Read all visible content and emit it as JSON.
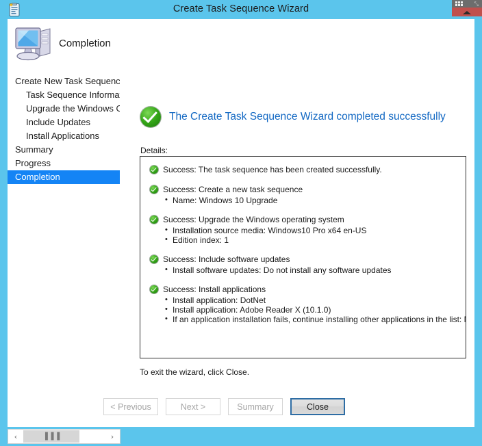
{
  "window": {
    "title": "Create Task Sequence Wizard",
    "title_icon": "task-sequence-clipboard-icon",
    "close_icon": "caret-up-icon",
    "accent_color": "#5BC5EC",
    "close_button_color": "#C0504D"
  },
  "overlay_toolbar": {
    "grip_icon": "drag-handle-dots-icon",
    "expand_icon": "expand-arrows-icon",
    "expand_glyph": "⤡"
  },
  "header": {
    "icon": "computer-monitor-icon",
    "title": "Completion"
  },
  "sidebar": {
    "selected_color": "#1484F5",
    "items": [
      {
        "label": "Create New Task Sequence",
        "level": 0,
        "selected": false
      },
      {
        "label": "Task Sequence Information",
        "level": 1,
        "selected": false
      },
      {
        "label": "Upgrade the Windows Operating System",
        "level": 1,
        "selected": false
      },
      {
        "label": "Include Updates",
        "level": 1,
        "selected": false
      },
      {
        "label": "Install Applications",
        "level": 1,
        "selected": false
      },
      {
        "label": "Summary",
        "level": 0,
        "selected": false
      },
      {
        "label": "Progress",
        "level": 0,
        "selected": false
      },
      {
        "label": "Completion",
        "level": 0,
        "selected": true
      }
    ]
  },
  "main": {
    "status_icon": "success-check-icon",
    "status_text": "The Create Task Sequence Wizard completed successfully",
    "status_color": "#1268C3",
    "details_label": "Details:",
    "exit_hint": "To exit the wizard, click Close.",
    "results": [
      {
        "icon": "success-check-icon",
        "heading": "Success: The task sequence has been created successfully.",
        "bullets": []
      },
      {
        "icon": "success-check-icon",
        "heading": "Success: Create a new task sequence",
        "bullets": [
          "Name: Windows 10 Upgrade"
        ]
      },
      {
        "icon": "success-check-icon",
        "heading": "Success: Upgrade the Windows operating system",
        "bullets": [
          "Installation source media:  Windows10 Pro x64 en-US",
          "Edition index: 1"
        ]
      },
      {
        "icon": "success-check-icon",
        "heading": "Success: Include software updates",
        "bullets": [
          "Install software updates: Do not install any software updates"
        ]
      },
      {
        "icon": "success-check-icon",
        "heading": "Success: Install applications",
        "bullets": [
          "Install application: DotNet",
          "Install application: Adobe Reader X (10.1.0)",
          "If an application installation fails, continue installing other applications in the list: No"
        ]
      }
    ]
  },
  "buttons": {
    "previous": {
      "label": "< Previous",
      "enabled": false
    },
    "next": {
      "label": "Next >",
      "enabled": false
    },
    "summary": {
      "label": "Summary",
      "enabled": false
    },
    "close": {
      "label": "Close",
      "enabled": true
    }
  },
  "scrollbar": {
    "left_arrow": "‹",
    "right_arrow": "›",
    "thumb_grip": "▐▐▐"
  }
}
